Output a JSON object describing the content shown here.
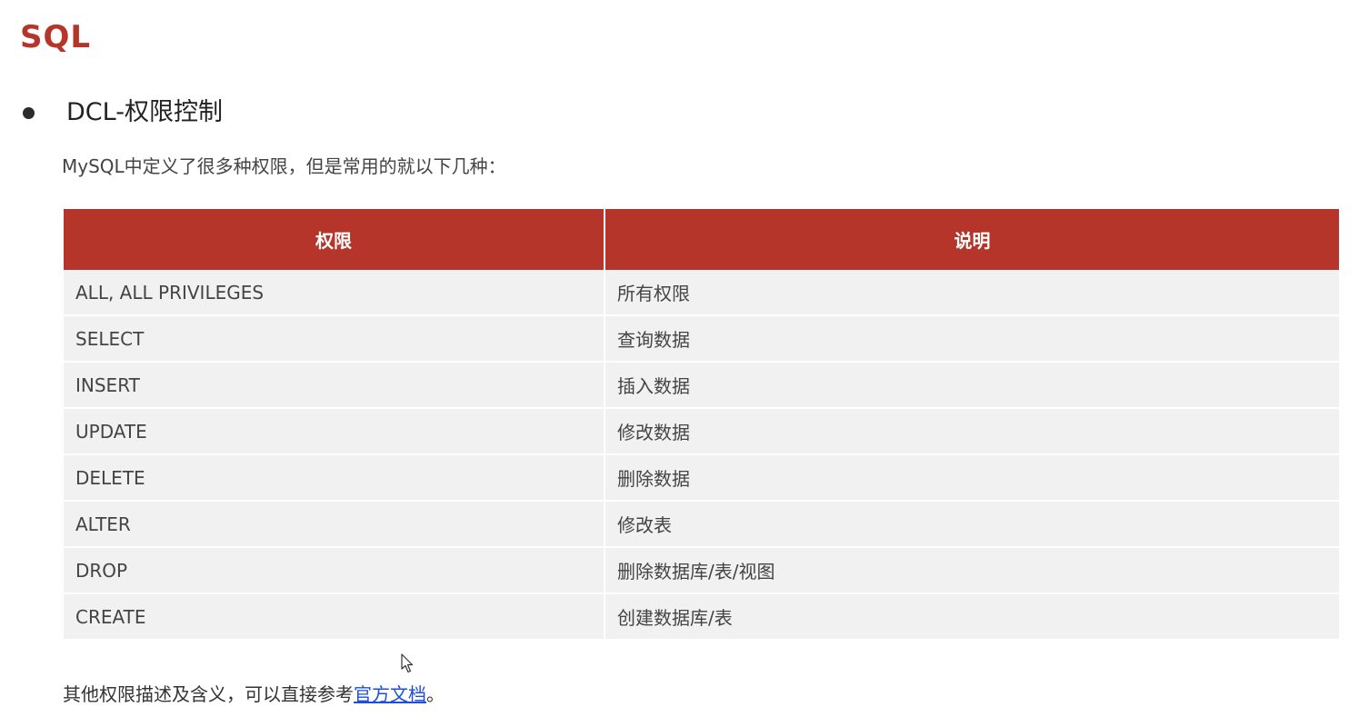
{
  "page": {
    "title": "SQL"
  },
  "section": {
    "heading": "DCL-权限控制",
    "intro": "MySQL中定义了很多种权限，但是常用的就以下几种："
  },
  "table": {
    "headers": [
      "权限",
      "说明"
    ],
    "rows": [
      {
        "privilege": "ALL, ALL PRIVILEGES",
        "description": "所有权限"
      },
      {
        "privilege": "SELECT",
        "description": "查询数据"
      },
      {
        "privilege": "INSERT",
        "description": "插入数据"
      },
      {
        "privilege": "UPDATE",
        "description": "修改数据"
      },
      {
        "privilege": "DELETE",
        "description": "删除数据"
      },
      {
        "privilege": "ALTER",
        "description": "修改表"
      },
      {
        "privilege": "DROP",
        "description": "删除数据库/表/视图"
      },
      {
        "privilege": "CREATE",
        "description": "创建数据库/表"
      }
    ]
  },
  "footer": {
    "prefix": "其他权限描述及含义，可以直接参考",
    "link_text": "官方文档",
    "suffix": "。"
  },
  "colors": {
    "accent": "#b5352a",
    "link": "#1d4fd8",
    "row_bg": "#f1f1f1"
  },
  "icons": {
    "cursor": "mouse-pointer-icon",
    "bullet": "bullet-dot-icon"
  }
}
